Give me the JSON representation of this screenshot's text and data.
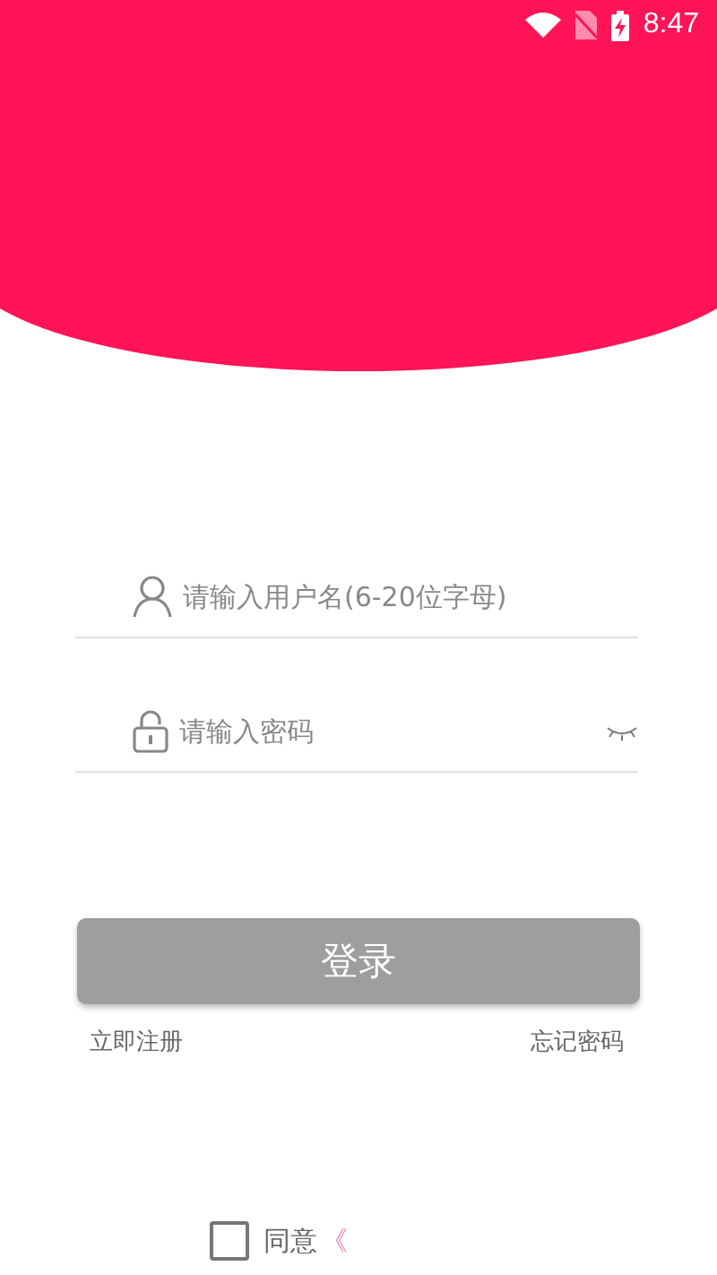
{
  "status_bar": {
    "time": "8:47"
  },
  "username": {
    "placeholder": "请输入用户名(6-20位字母)"
  },
  "password": {
    "placeholder": "请输入密码"
  },
  "login_button": "登录",
  "links": [
    {
      "label": "立即注册"
    },
    {
      "label": "忘记密码"
    }
  ],
  "agreement": {
    "checked": false,
    "text": "同意",
    "link": "《"
  }
}
